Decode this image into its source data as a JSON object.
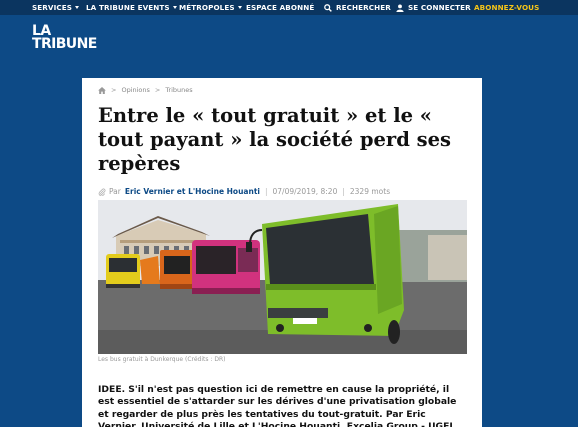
{
  "nav": {
    "services": "SERVICES",
    "events": "LA TRIBUNE EVENTS",
    "metropoles": "MÉTROPOLES",
    "espace": "ESPACE ABONNÉ",
    "search": "RECHERCHER",
    "login": "SE CONNECTER",
    "subscribe": "ABONNEZ-VOUS"
  },
  "logo": {
    "line1": "LA",
    "line2": "TRIBUNE"
  },
  "breadcrumb": {
    "level1": "Opinions",
    "level2": "Tribunes"
  },
  "article": {
    "title": "Entre le « tout gratuit » et le « tout payant » la société perd ses repères",
    "by": "Par",
    "authors": "Eric Vernier et L'Hocine Houanti",
    "date": "07/09/2019, 8:20",
    "word_count": "2329  mots",
    "caption": "Les bus gratuit à Dunkerque (Crédits : DR)",
    "lead": "IDEE. S'il n'est pas question ici de remettre en cause la propriété, il est essentiel de s'attarder sur les dérives d'une privatisation globale et regarder de plus près les tentatives du tout-gratuit. Par Eric Vernier, Université de Lille et L'Hocine Houanti, Excelia Group - UGEI"
  },
  "colors": {
    "background": "#0d4a86",
    "topbar": "#0b3560",
    "subscribe": "#f5c518",
    "author_link": "#0d4a86"
  }
}
